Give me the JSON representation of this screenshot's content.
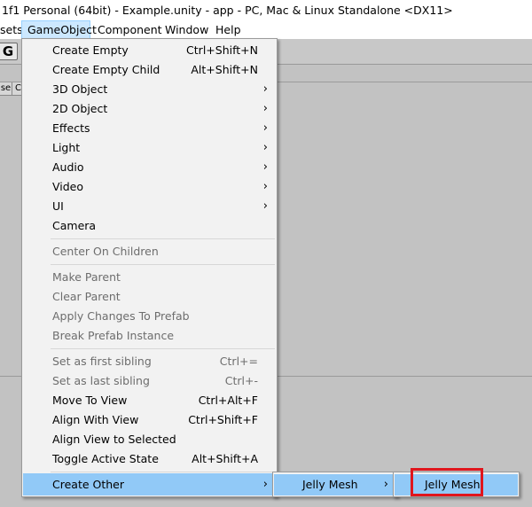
{
  "window": {
    "title": "1f1 Personal (64bit) - Example.unity - app - PC, Mac & Linux Standalone <DX11>"
  },
  "menubar": {
    "items": [
      {
        "label": "sets"
      },
      {
        "label": "GameObject"
      },
      {
        "label": "Component"
      },
      {
        "label": "Window"
      },
      {
        "label": "Help"
      }
    ]
  },
  "toolbar": {
    "button_glyph": "G"
  },
  "panel": {
    "header_tabs": [
      "se",
      "C"
    ]
  },
  "gameobject_menu": {
    "create_empty": {
      "label": "Create Empty",
      "shortcut": "Ctrl+Shift+N"
    },
    "create_empty_child": {
      "label": "Create Empty Child",
      "shortcut": "Alt+Shift+N"
    },
    "object_3d": {
      "label": "3D Object"
    },
    "object_2d": {
      "label": "2D Object"
    },
    "effects": {
      "label": "Effects"
    },
    "light": {
      "label": "Light"
    },
    "audio": {
      "label": "Audio"
    },
    "video": {
      "label": "Video"
    },
    "ui": {
      "label": "UI"
    },
    "camera": {
      "label": "Camera"
    },
    "center_on_children": {
      "label": "Center On Children"
    },
    "make_parent": {
      "label": "Make Parent"
    },
    "clear_parent": {
      "label": "Clear Parent"
    },
    "apply_changes": {
      "label": "Apply Changes To Prefab"
    },
    "break_prefab": {
      "label": "Break Prefab Instance"
    },
    "first_sibling": {
      "label": "Set as first sibling",
      "shortcut": "Ctrl+="
    },
    "last_sibling": {
      "label": "Set as last sibling",
      "shortcut": "Ctrl+-"
    },
    "move_to_view": {
      "label": "Move To View",
      "shortcut": "Ctrl+Alt+F"
    },
    "align_with_view": {
      "label": "Align With View",
      "shortcut": "Ctrl+Shift+F"
    },
    "align_view_to_selected": {
      "label": "Align View to Selected"
    },
    "toggle_active": {
      "label": "Toggle Active State",
      "shortcut": "Alt+Shift+A"
    },
    "create_other": {
      "label": "Create Other"
    }
  },
  "submenu_create_other": {
    "jelly_mesh": {
      "label": "Jelly Mesh"
    }
  },
  "submenu_jelly_mesh": {
    "jelly_mesh": {
      "label": "Jelly Mesh"
    }
  },
  "colors": {
    "highlight": "#91c9f7",
    "annotation_box": "#e0161d",
    "disabled_text": "#6d6d6d"
  }
}
